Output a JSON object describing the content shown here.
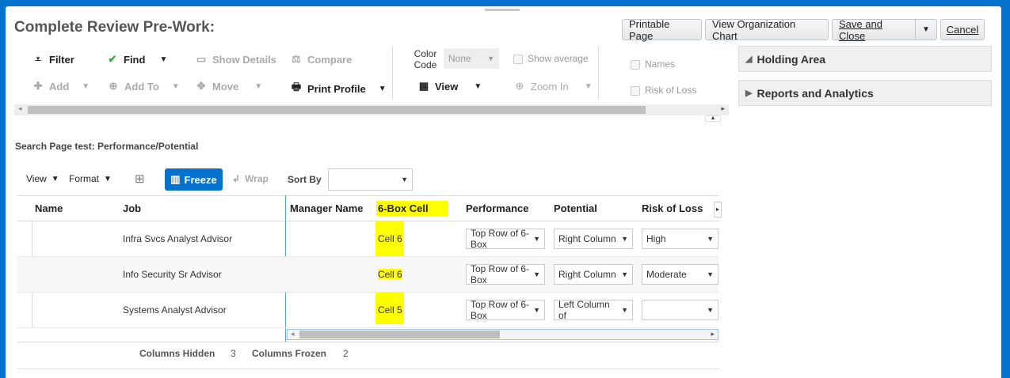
{
  "header": {
    "title": "Complete Review Pre-Work:"
  },
  "buttons": {
    "printable": "Printable Page",
    "org_chart": "View Organization Chart",
    "save_close": "Save and Close",
    "cancel": "Cancel"
  },
  "toolbar": {
    "filter": "Filter",
    "find": "Find",
    "show_details": "Show Details",
    "compare": "Compare",
    "add": "Add",
    "add_to": "Add To",
    "move": "Move",
    "print_profile": "Print Profile",
    "color_code_label": "Color Code",
    "color_code_value": "None",
    "show_average": "Show average",
    "view": "View",
    "zoom_in": "Zoom In",
    "names": "Names",
    "risk_of_loss": "Risk of Loss"
  },
  "side": {
    "holding_area": "Holding Area",
    "reports": "Reports and Analytics"
  },
  "search": {
    "title": "Search Page test: Performance/Potential"
  },
  "table_toolbar": {
    "view": "View",
    "format": "Format",
    "freeze": "Freeze",
    "wrap": "Wrap",
    "sort_by": "Sort By",
    "sort_value": ""
  },
  "table": {
    "columns": [
      "Name",
      "Job",
      "Manager Name",
      "6-Box Cell",
      "Performance",
      "Potential",
      "Risk of Loss"
    ],
    "rows": [
      {
        "name": "",
        "job": "Infra Svcs Analyst Advisor",
        "manager": "",
        "cell": "Cell 6",
        "performance": "Top Row of 6-Box",
        "potential": "Right Column",
        "risk": "High"
      },
      {
        "name": "",
        "job": "Info Security Sr Advisor",
        "manager": "",
        "cell": "Cell 6",
        "performance": "Top Row of 6-Box",
        "potential": "Right Column",
        "risk": "Moderate"
      },
      {
        "name": "",
        "job": "Systems Analyst Advisor",
        "manager": "",
        "cell": "Cell 5",
        "performance": "Top Row of 6-Box",
        "potential": "Left Column of",
        "risk": ""
      }
    ]
  },
  "footer": {
    "hidden_label": "Columns Hidden",
    "hidden_value": "3",
    "frozen_label": "Columns Frozen",
    "frozen_value": "2"
  }
}
